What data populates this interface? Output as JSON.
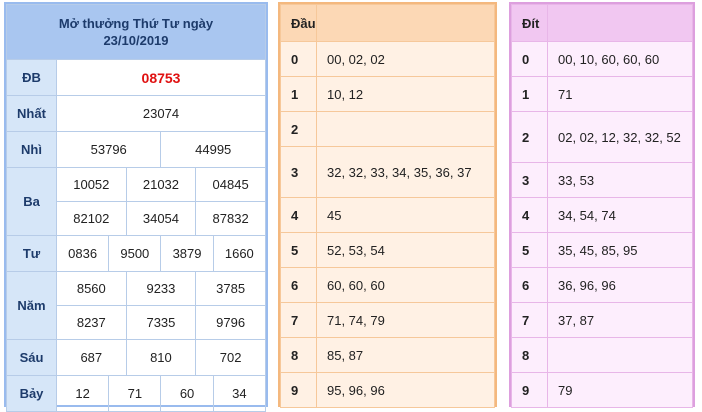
{
  "results": {
    "title": "Mở thưởng Thứ Tư ngày",
    "date": "23/10/2019",
    "labels": {
      "db": "ĐB",
      "nhat": "Nhất",
      "nhi": "Nhì",
      "ba": "Ba",
      "tu": "Tư",
      "nam": "Năm",
      "sau": "Sáu",
      "bay": "Bảy"
    },
    "db": "08753",
    "nhat": "23074",
    "nhi": [
      "53796",
      "44995"
    ],
    "ba": [
      "10052",
      "21032",
      "04845",
      "82102",
      "34054",
      "87832"
    ],
    "tu": [
      "0836",
      "9500",
      "3879",
      "1660"
    ],
    "nam": [
      "8560",
      "9233",
      "3785",
      "8237",
      "7335",
      "9796"
    ],
    "sau": [
      "687",
      "810",
      "702"
    ],
    "bay": [
      "12",
      "71",
      "60",
      "34"
    ],
    "special_color": "#e01010"
  },
  "dau": {
    "header": "Đầu",
    "rows": [
      {
        "d": "0",
        "v": "00, 02, 02"
      },
      {
        "d": "1",
        "v": "10, 12"
      },
      {
        "d": "2",
        "v": ""
      },
      {
        "d": "3",
        "v": "32, 32, 33, 34, 35, 36, 37"
      },
      {
        "d": "4",
        "v": "45"
      },
      {
        "d": "5",
        "v": "52, 53, 54"
      },
      {
        "d": "6",
        "v": "60, 60, 60"
      },
      {
        "d": "7",
        "v": "71, 74, 79"
      },
      {
        "d": "8",
        "v": "85, 87"
      },
      {
        "d": "9",
        "v": "95, 96, 96"
      }
    ]
  },
  "dit": {
    "header": "Đít",
    "rows": [
      {
        "d": "0",
        "v": "00, 10, 60, 60, 60"
      },
      {
        "d": "1",
        "v": "71"
      },
      {
        "d": "2",
        "v": "02, 02, 12, 32, 32, 52"
      },
      {
        "d": "3",
        "v": "33, 53"
      },
      {
        "d": "4",
        "v": "34, 54, 74"
      },
      {
        "d": "5",
        "v": "35, 45, 85, 95"
      },
      {
        "d": "6",
        "v": "36, 96, 96"
      },
      {
        "d": "7",
        "v": "37, 87"
      },
      {
        "d": "8",
        "v": ""
      },
      {
        "d": "9",
        "v": "79"
      }
    ]
  }
}
